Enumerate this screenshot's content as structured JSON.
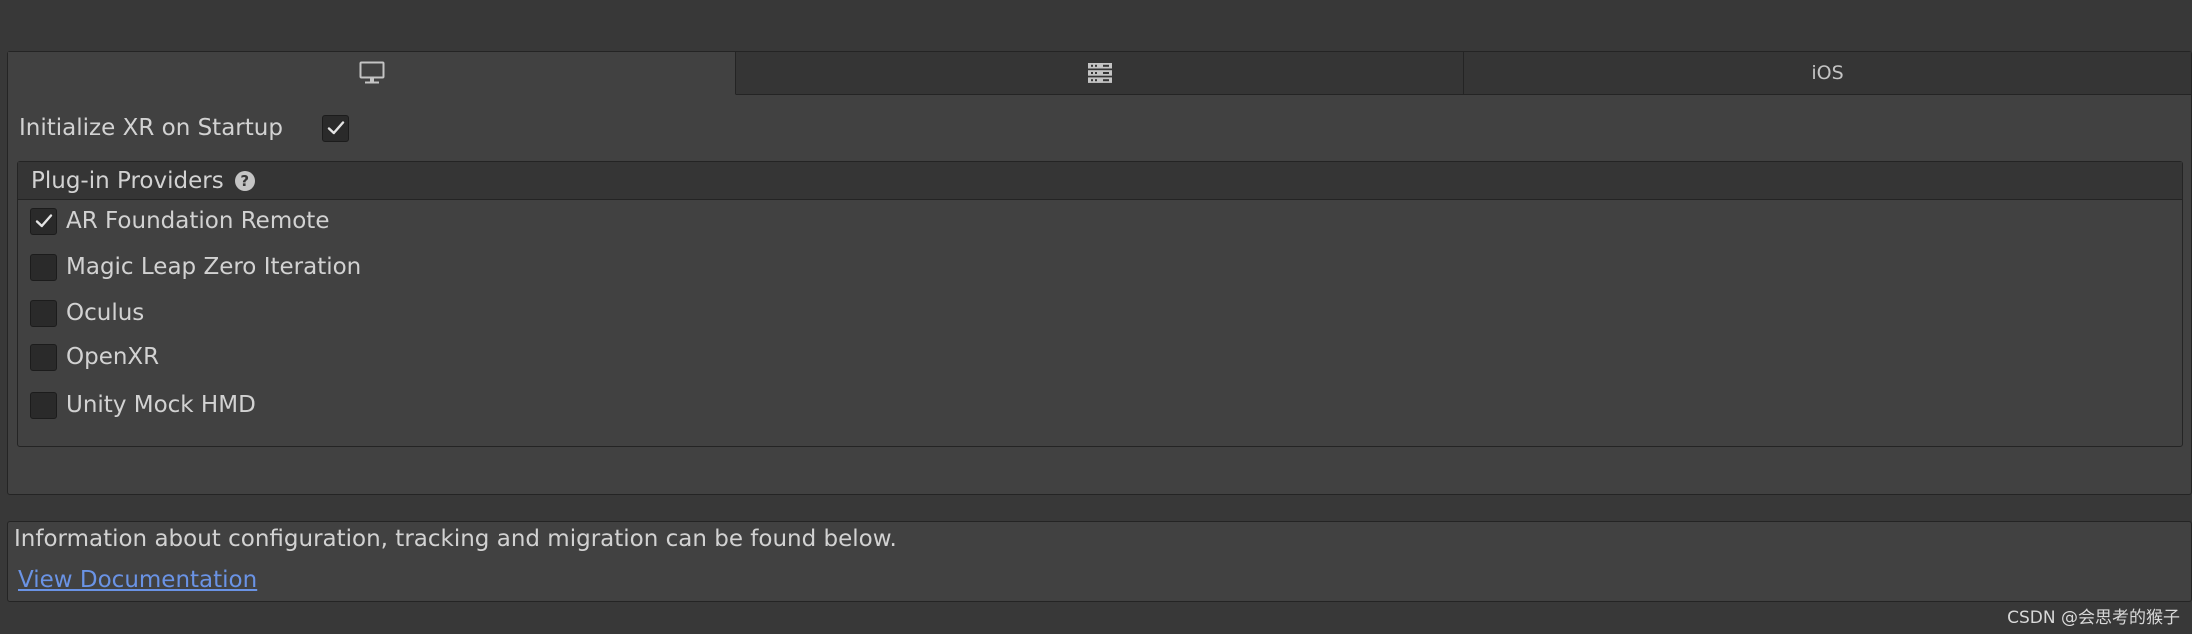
{
  "tabs": [
    {
      "icon": "desktop-icon",
      "label": "",
      "active": true
    },
    {
      "icon": "server-icon",
      "label": "",
      "active": false
    },
    {
      "icon": "",
      "label": "iOS",
      "active": false
    }
  ],
  "init_xr": {
    "label": "Initialize XR on Startup",
    "checked": true
  },
  "providers": {
    "title": "Plug-in Providers",
    "help_glyph": "?",
    "items": [
      {
        "label": "AR Foundation Remote",
        "checked": true
      },
      {
        "label": "Magic Leap Zero Iteration",
        "checked": false
      },
      {
        "label": "Oculus",
        "checked": false
      },
      {
        "label": "OpenXR",
        "checked": false
      },
      {
        "label": "Unity Mock HMD",
        "checked": false
      }
    ]
  },
  "info": {
    "text": "Information about configuration, tracking and migration can be found below.",
    "link": "View Documentation"
  },
  "watermark": "CSDN @会思考的猴子",
  "colors": {
    "background": "#383838",
    "panel": "#414141",
    "tab_inactive": "#353535",
    "link": "#6a93e5"
  }
}
